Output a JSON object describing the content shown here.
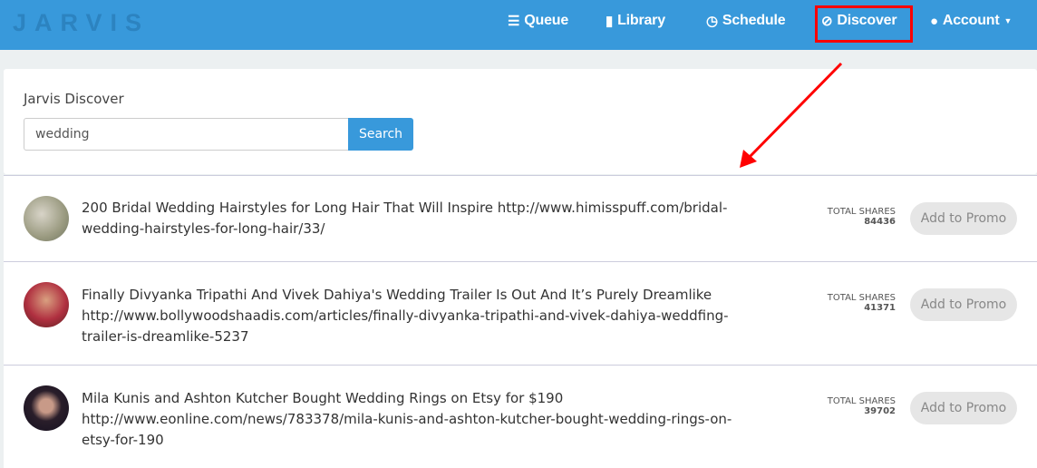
{
  "nav": {
    "logo": "JARVIS",
    "items": [
      {
        "label": "Queue",
        "icon": "list-icon"
      },
      {
        "label": "Library",
        "icon": "book-icon"
      },
      {
        "label": "Schedule",
        "icon": "clock-icon"
      },
      {
        "label": "Discover",
        "icon": "compass-icon"
      },
      {
        "label": "Account",
        "icon": "user-icon"
      }
    ]
  },
  "search": {
    "title": "Jarvis Discover",
    "value": "wedding",
    "button": "Search"
  },
  "results": [
    {
      "text": "200 Bridal Wedding Hairstyles for Long Hair That Will Inspire http://www.himisspuff.com/bridal-wedding-hairstyles-for-long-hair/33/",
      "shares_label": "TOTAL SHARES",
      "shares": "84436",
      "button": "Add to Promo"
    },
    {
      "text": "Finally Divyanka Tripathi And Vivek Dahiya's Wedding Trailer Is Out And It’s Purely Dreamlike http://www.bollywoodshaadis.com/articles/finally-divyanka-tripathi-and-vivek-dahiya-weddfing-trailer-is-dreamlike-5237",
      "shares_label": "TOTAL SHARES",
      "shares": "41371",
      "button": "Add to Promo"
    },
    {
      "text": "Mila Kunis and Ashton Kutcher Bought Wedding Rings on Etsy for $190 http://www.eonline.com/news/783378/mila-kunis-and-ashton-kutcher-bought-wedding-rings-on-etsy-for-190",
      "shares_label": "TOTAL SHARES",
      "shares": "39702",
      "button": "Add to Promo"
    }
  ],
  "colors": {
    "nav": "#3899db",
    "highlight": "#ff0000"
  }
}
